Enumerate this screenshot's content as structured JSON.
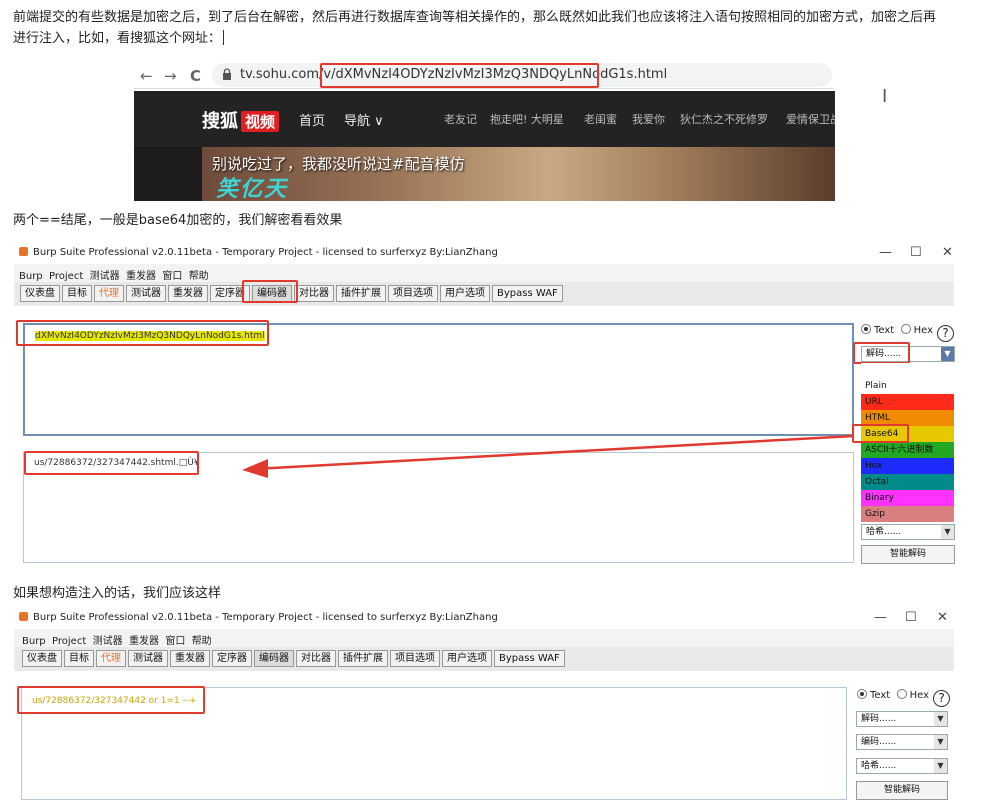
{
  "article": {
    "para1_line1": "前端提交的有些数据是加密之后，到了后台在解密，然后再进行数据库查询等相关操作的，那么既然如此我们也应该将注入语句按照相同的加密方式，加密之后再",
    "para1_line2": "进行注入，比如，看搜狐这个网址：",
    "para2": "两个==结尾，一般是base64加密的，我们解密看看效果",
    "para3": "如果想构造注入的话，我们应该这样"
  },
  "browser": {
    "back": "←",
    "forward": "→",
    "reload": "C",
    "url_prefix": "tv.sohu.com/v",
    "url_highlight": "/dXMvNzI4ODYzNzIvMzI3MzQ3NDQyLnNodG1s",
    "url_suffix": ".html"
  },
  "sohu": {
    "logo": "搜狐",
    "logo_badge": "视频",
    "menu_home": "首页",
    "menu_nav": "导航 ∨",
    "links": [
      "老友记",
      "抱走吧! 大明星",
      "老闺蜜",
      "我爱你",
      "狄仁杰之不死修罗",
      "爱情保卫战"
    ],
    "banner_text": "别说吃过了，我都没听说过#配音模仿",
    "banner_art": "笑亿天"
  },
  "burp1": {
    "title": "Burp Suite Professional v2.0.11beta - Temporary Project - licensed to surferxyz By:LianZhang",
    "win_min": "—",
    "win_max": "☐",
    "win_close": "✕",
    "menu": [
      "Burp",
      "Project",
      "测试器",
      "重发器",
      "窗口",
      "帮助"
    ],
    "tabs": [
      "仪表盘",
      "目标",
      "代理",
      "测试器",
      "重发器",
      "定序器",
      "编码器",
      "对比器",
      "插件扩展",
      "项目选项",
      "用户选项",
      "Bypass WAF"
    ],
    "input_text": "dXMvNzI4ODYzNzIvMzI3MzQ3NDQyLnNodG1s.html",
    "output_text": "us/72886372/327347442.shtml.□Ù¥",
    "radio_text": "Text",
    "radio_hex": "Hex",
    "decode_select": "解码......",
    "dropdown_items": [
      {
        "label": "Plain",
        "color": "#ffffff"
      },
      {
        "label": "URL",
        "color": "#ff2a1a"
      },
      {
        "label": "HTML",
        "color": "#f08a00"
      },
      {
        "label": "Base64",
        "color": "#e6c700"
      },
      {
        "label": "ASCII十六进制数",
        "color": "#23a823"
      },
      {
        "label": "Hex",
        "color": "#1d2bff"
      },
      {
        "label": "Octal",
        "color": "#008b8b"
      },
      {
        "label": "Binary",
        "color": "#ff33ff"
      },
      {
        "label": "Gzip",
        "color": "#d97f7f"
      }
    ],
    "hash_select": "哈希......",
    "smart_decode": "智能解码"
  },
  "burp2": {
    "title": "Burp Suite Professional v2.0.11beta - Temporary Project - licensed to surferxyz By:LianZhang",
    "win_min": "—",
    "win_max": "☐",
    "win_close": "✕",
    "menu": [
      "Burp",
      "Project",
      "测试器",
      "重发器",
      "窗口",
      "帮助"
    ],
    "tabs": [
      "仪表盘",
      "目标",
      "代理",
      "测试器",
      "重发器",
      "定序器",
      "编码器",
      "对比器",
      "插件扩展",
      "项目选项",
      "用户选项",
      "Bypass WAF"
    ],
    "input_text": "us/72886372/327347442 or 1=1 --+",
    "radio_text": "Text",
    "radio_hex": "Hex",
    "decode_select": "解码......",
    "encode_select": "编码......",
    "hash_select": "哈希......",
    "smart_decode": "智能解码"
  },
  "colors": {
    "highlight_red": "#e03a2f",
    "text_highlight": "#e6e600",
    "proxy_tab": "#e8742b"
  }
}
